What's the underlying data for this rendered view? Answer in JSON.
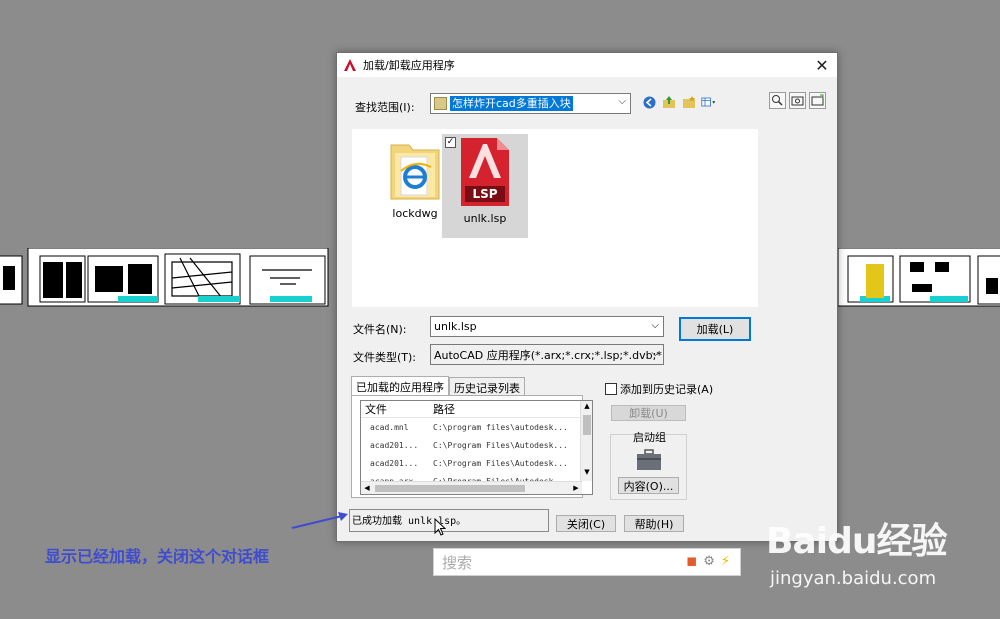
{
  "dialog": {
    "title": "加载/卸载应用程序",
    "close_glyph": "✕",
    "look_in_label": "查找范围(I):",
    "look_in_value": "怎样炸开cad多重插入块",
    "files": [
      {
        "name": "lockdwg",
        "icon": "folder-ie-icon"
      },
      {
        "name": "unlk.lsp",
        "icon": "lsp-file-icon",
        "badge": "LSP",
        "selected": true
      }
    ],
    "filename_label": "文件名(N):",
    "filename_value": "unlk.lsp",
    "filetype_label": "文件类型(T):",
    "filetype_value": "AutoCAD 应用程序(*.arx;*.crx;*.lsp;*.dvb;*.dbx",
    "load_button": "加载(L)",
    "tabs": [
      "已加载的应用程序",
      "历史记录列表"
    ],
    "list_headers": {
      "file": "文件",
      "path": "路径"
    },
    "list_rows": [
      {
        "file": "acad.mnl",
        "path": "C:\\program files\\autodesk..."
      },
      {
        "file": "acad201...",
        "path": "C:\\Program Files\\Autodesk..."
      },
      {
        "file": "acad201...",
        "path": "C:\\Program Files\\Autodesk..."
      },
      {
        "file": "acapp.arx",
        "path": "C:\\Program Files\\Autodesk..."
      }
    ],
    "add_history_label": "添加到历史记录(A)",
    "unload_button": "卸载(U)",
    "startup_group_label": "启动组",
    "contents_button": "内容(O)...",
    "status_text": "已成功加载 unlk.lsp。",
    "close_button": "关闭(C)",
    "help_button": "帮助(H)"
  },
  "annotation_text": "显示已经加载，关闭这个对话框",
  "search": {
    "placeholder": "搜索"
  },
  "watermark": {
    "brand": "Baidu经验",
    "url": "jingyan.baidu.com"
  },
  "colors": {
    "accent": "#0078d7",
    "annotation": "#3f4ccf",
    "background": "#8c8c8c",
    "autocad_red": "#c8102e"
  }
}
